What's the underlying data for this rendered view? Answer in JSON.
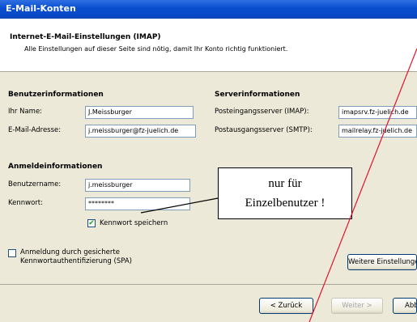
{
  "window": {
    "title": "E-Mail-Konten"
  },
  "header": {
    "title": "Internet-E-Mail-Einstellungen (IMAP)",
    "description": "Alle Einstellungen auf dieser Seite sind nötig, damit Ihr Konto richtig funktioniert."
  },
  "user_info": {
    "title": "Benutzerinformationen",
    "name_label": "Ihr Name:",
    "name_value": "J.Meissburger",
    "email_label": "E-Mail-Adresse:",
    "email_value": "j.meissburger@fz-juelich.de"
  },
  "server_info": {
    "title": "Serverinformationen",
    "incoming_label": "Posteingangsserver (IMAP):",
    "incoming_value": "imapsrv.fz-juelich.de",
    "outgoing_label": "Postausgangsserver (SMTP):",
    "outgoing_value": "mailrelay.fz-juelich.de"
  },
  "login_info": {
    "title": "Anmeldeinformationen",
    "username_label": "Benutzername:",
    "username_value": "j.meissburger",
    "password_label": "Kennwort:",
    "password_value": "********",
    "save_password_label": "Kennwort speichern",
    "save_password_checked": true
  },
  "spa": {
    "label_line1": "Anmeldung durch gesicherte",
    "label_line2": "Kennwortauthentifizierung (SPA)",
    "checked": false
  },
  "buttons": {
    "more_settings": "Weitere Einstellungen...",
    "back": "< Zurück",
    "next": "Weiter >",
    "cancel": "Abbrechen"
  },
  "annotation": {
    "line1": "nur für",
    "line2": "Einzelbenutzer !"
  },
  "colors": {
    "titlebar": "#0a4fd0",
    "dialog_bg": "#ece9d8",
    "annotation_line": "#e0142a",
    "checkmark": "#21a121"
  }
}
